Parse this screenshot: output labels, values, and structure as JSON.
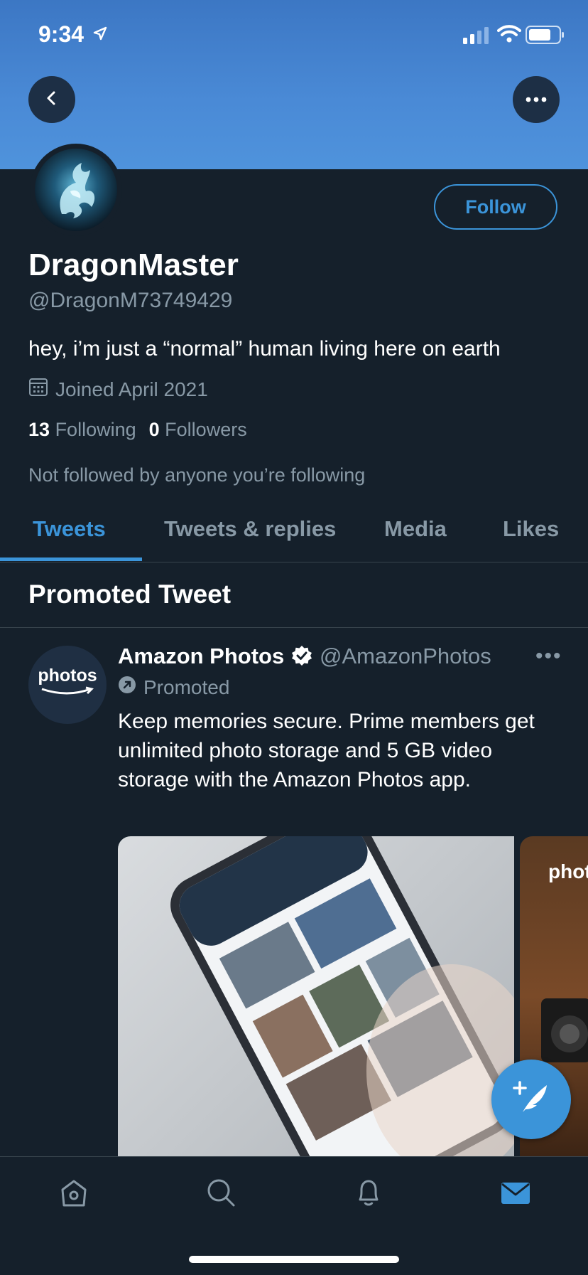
{
  "status_bar": {
    "time": "9:34"
  },
  "profile": {
    "name": "DragonMaster",
    "handle": "@DragonM73749429",
    "bio": "hey, i’m just a “normal” human living here on earth",
    "joined": "Joined April 2021",
    "following_count": "13",
    "following_label": "Following",
    "followers_count": "0",
    "followers_label": "Followers",
    "not_followed_text": "Not followed by anyone you’re following",
    "follow_button": "Follow"
  },
  "tabs": [
    {
      "label": "Tweets",
      "active": true
    },
    {
      "label": "Tweets & replies",
      "active": false
    },
    {
      "label": "Media",
      "active": false
    },
    {
      "label": "Likes",
      "active": false
    }
  ],
  "promoted_section": {
    "header": "Promoted Tweet",
    "tweet": {
      "avatar_text": "photos",
      "author_name": "Amazon Photos",
      "author_handle": "@AmazonPhotos",
      "promoted_label": "Promoted",
      "more_label": "•••",
      "text": "Keep memories secure. Prime members get unlimited photo storage and 5 GB video storage with the Amazon Photos app.",
      "media_second_text": "photos"
    }
  },
  "icons": {
    "back": "chevron-left-icon",
    "more": "more-horizontal-icon",
    "calendar": "calendar-icon",
    "verified": "verified-badge-icon",
    "promoted": "promoted-arrow-icon",
    "compose": "compose-tweet-icon",
    "nav": [
      "home-icon",
      "search-icon",
      "notifications-icon",
      "messages-icon"
    ]
  },
  "colors": {
    "background": "#15202b",
    "accent": "#3b94d9",
    "secondary_text": "#8899a6",
    "banner": "#4a8ad6"
  }
}
